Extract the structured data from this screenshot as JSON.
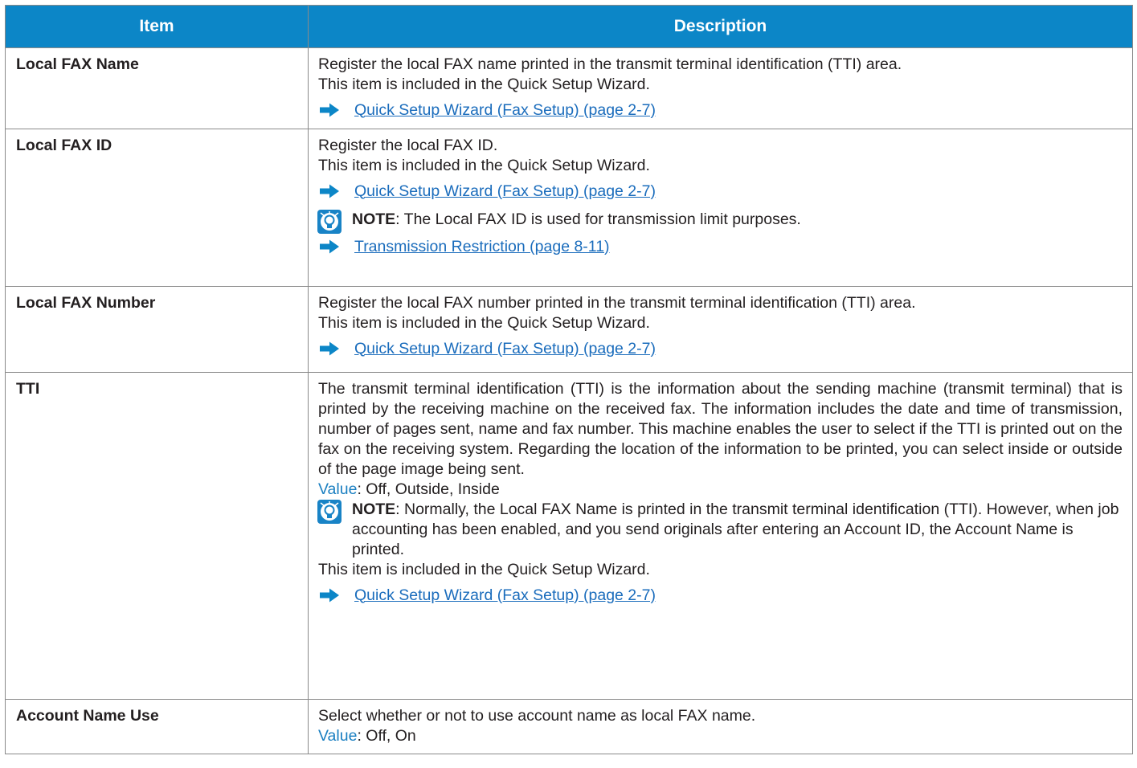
{
  "header": {
    "item": "Item",
    "description": "Description"
  },
  "rows": [
    {
      "item": "Local FAX Name",
      "line1": "Register the local FAX name printed in the transmit terminal identification (TTI) area.",
      "line2": "This item is included in the Quick Setup Wizard.",
      "link": "Quick Setup Wizard (Fax Setup) (page 2-7)"
    },
    {
      "item": "Local FAX ID",
      "line1": "Register the local FAX ID.",
      "line2": "This item is included in the Quick Setup Wizard.",
      "link": "Quick Setup Wizard (Fax Setup) (page 2-7)",
      "note_key": "NOTE",
      "note_text": ": The Local FAX ID is used for transmission limit purposes.",
      "link2": "Transmission Restriction (page 8-11)"
    },
    {
      "item": "Local FAX Number",
      "line1": "Register the local FAX number printed in the transmit terminal identification (TTI) area.",
      "line2": "This item is included in the Quick Setup Wizard.",
      "link": "Quick Setup Wizard (Fax Setup) (page 2-7)"
    },
    {
      "item": "TTI",
      "para": "The transmit terminal identification (TTI) is the information about the sending machine (transmit terminal) that is printed by the receiving machine on the received fax. The information includes the date and time of transmission, number of pages sent, name and fax number. This machine enables the user to select if the TTI is printed out on the fax on the receiving system. Regarding the location of the information to be printed, you can select inside or outside of the page image being sent.",
      "value_label": "Value",
      "value_text": ": Off, Outside, Inside",
      "note_key": "NOTE",
      "note_text": ": Normally, the Local FAX Name is printed in the transmit terminal identification (TTI). However, when job accounting has been enabled, and you send originals after entering an Account ID, the Account Name is printed.",
      "line2": "This item is included in the Quick Setup Wizard.",
      "link": "Quick Setup Wizard (Fax Setup) (page 2-7)"
    },
    {
      "item": "Account Name Use",
      "line1": "Select whether or not to use account name as local FAX name.",
      "value_label": "Value",
      "value_text": ": Off, On"
    }
  ],
  "colors": {
    "header_bg": "#0c86c7",
    "link": "#1a6cbc",
    "value_label": "#1a7fc1"
  },
  "icons": {
    "arrow": "right-arrow-icon",
    "note": "note-lightbulb-icon"
  }
}
